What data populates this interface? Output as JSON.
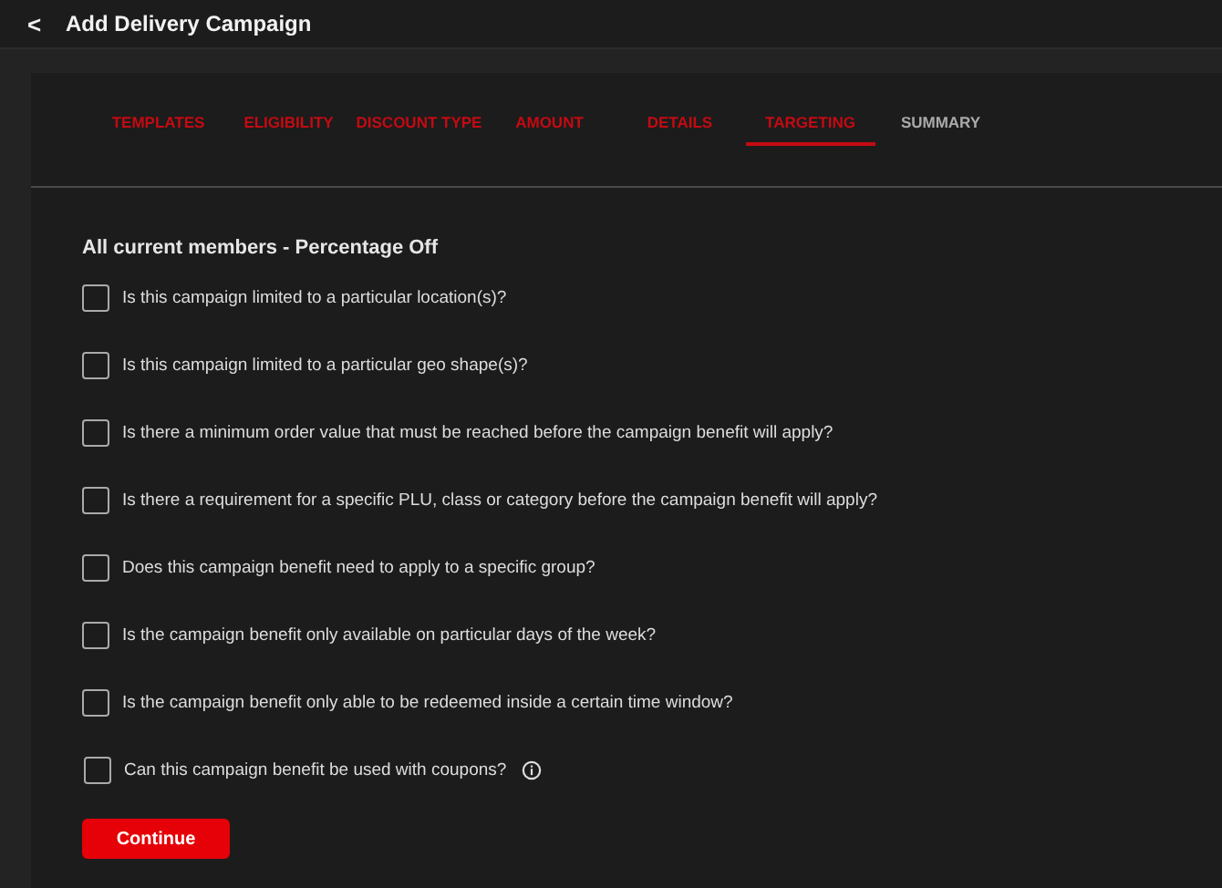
{
  "header": {
    "back": "<",
    "title": "Add Delivery Campaign"
  },
  "tabs": [
    {
      "label": "TEMPLATES",
      "selected": false,
      "completed": true
    },
    {
      "label": "ELIGIBILITY",
      "selected": false,
      "completed": true
    },
    {
      "label": "DISCOUNT TYPE",
      "selected": false,
      "completed": true
    },
    {
      "label": "AMOUNT",
      "selected": false,
      "completed": true
    },
    {
      "label": "DETAILS",
      "selected": false,
      "completed": true
    },
    {
      "label": "TARGETING",
      "selected": true,
      "completed": true
    },
    {
      "label": "SUMMARY",
      "selected": false,
      "completed": false
    }
  ],
  "heading": "All current members - Percentage Off",
  "questions": [
    {
      "kind": "plain",
      "label": "Is this campaign limited to a particular location(s)?",
      "checked": false
    },
    {
      "kind": "plain",
      "label": "Is this campaign limited to a particular geo shape(s)?",
      "checked": false
    },
    {
      "kind": "plain",
      "label": "Is there a minimum order value that must be reached before the campaign benefit will apply?",
      "checked": false
    },
    {
      "kind": "plain",
      "label": "Is there a requirement for a specific PLU, class or category before the campaign benefit will apply?",
      "checked": false
    },
    {
      "kind": "plain",
      "label": "Does this campaign benefit need to apply to a specific group?",
      "checked": false
    },
    {
      "kind": "plain",
      "label": "Is the campaign benefit only available on particular days of the week?",
      "checked": false
    },
    {
      "kind": "plain",
      "label": "Is the campaign benefit only able to be redeemed inside a certain time window?",
      "checked": false
    },
    {
      "kind": "info",
      "label": "Can this campaign benefit be used with coupons?",
      "checked": false
    }
  ],
  "continue_button": "Continue"
}
